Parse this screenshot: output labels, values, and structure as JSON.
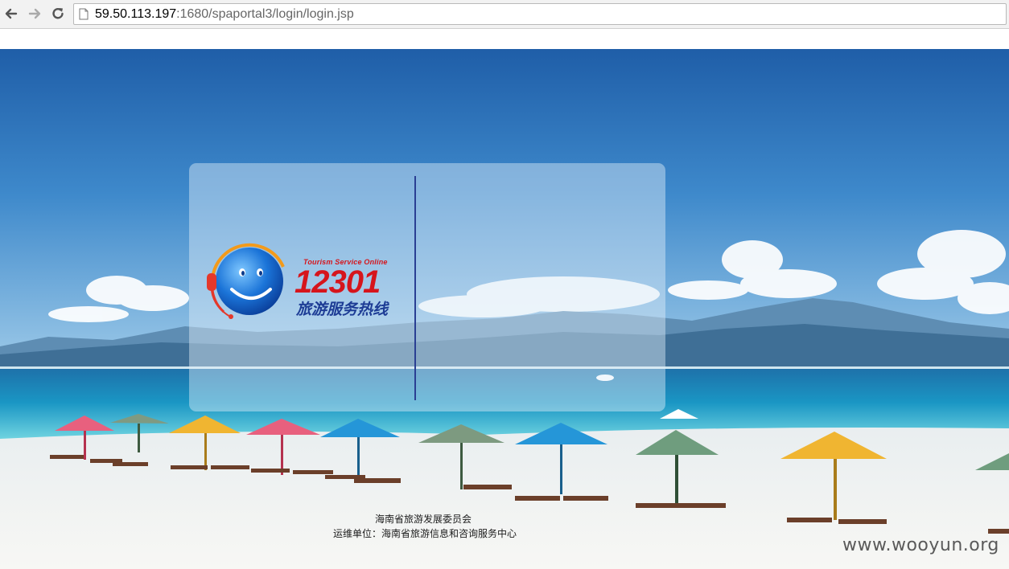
{
  "browser": {
    "url_host": "59.50.113.197",
    "url_path": ":1680/spaportal3/login/login.jsp",
    "back_icon": "back-arrow-icon",
    "forward_icon": "forward-arrow-icon",
    "reload_icon": "reload-icon",
    "page_icon": "page-icon"
  },
  "logo": {
    "tagline": "Tourism Service Online",
    "number": "12301",
    "name_cn": "旅游服务热线",
    "icon": "smiley-headset-icon"
  },
  "footer": {
    "line1": "海南省旅游发展委员会",
    "line2": "运维单位：海南省旅游信息和咨询服务中心"
  },
  "watermark": "www.wooyun.org",
  "colors": {
    "brand_red": "#d6151c",
    "brand_blue": "#1d3c95",
    "divider": "#2a3f93"
  }
}
